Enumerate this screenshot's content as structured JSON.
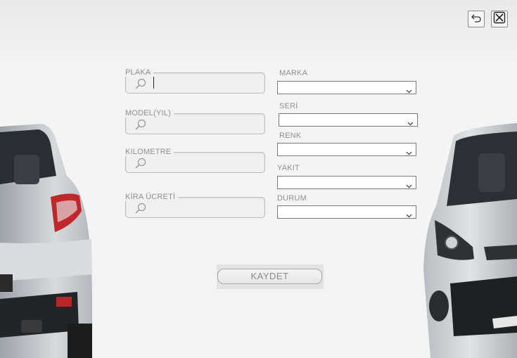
{
  "form": {
    "plaka_label": "PLAKA",
    "model_label": "MODEL(YIL)",
    "kilometre_label": "KILOMETRE",
    "kira_label": "KİRA ÜCRETİ",
    "marka_label": "MARKA",
    "seri_label": "SERİ",
    "renk_label": "RENK",
    "yakit_label": "YAKIT",
    "durum_label": "DURUM",
    "plaka_value": "",
    "model_value": "",
    "kilometre_value": "",
    "kira_value": "",
    "marka_value": "",
    "seri_value": "",
    "renk_value": "",
    "yakit_value": "",
    "durum_value": ""
  },
  "actions": {
    "save_label": "KAYDET"
  },
  "icons": {
    "undo": "undo-icon",
    "close": "close-icon",
    "search": "search-icon",
    "dropdown": "chevron-down-icon"
  },
  "colors": {
    "background": "#f3f3f3",
    "car_silver": "#cfd2d5",
    "taillight": "#c0262a"
  }
}
